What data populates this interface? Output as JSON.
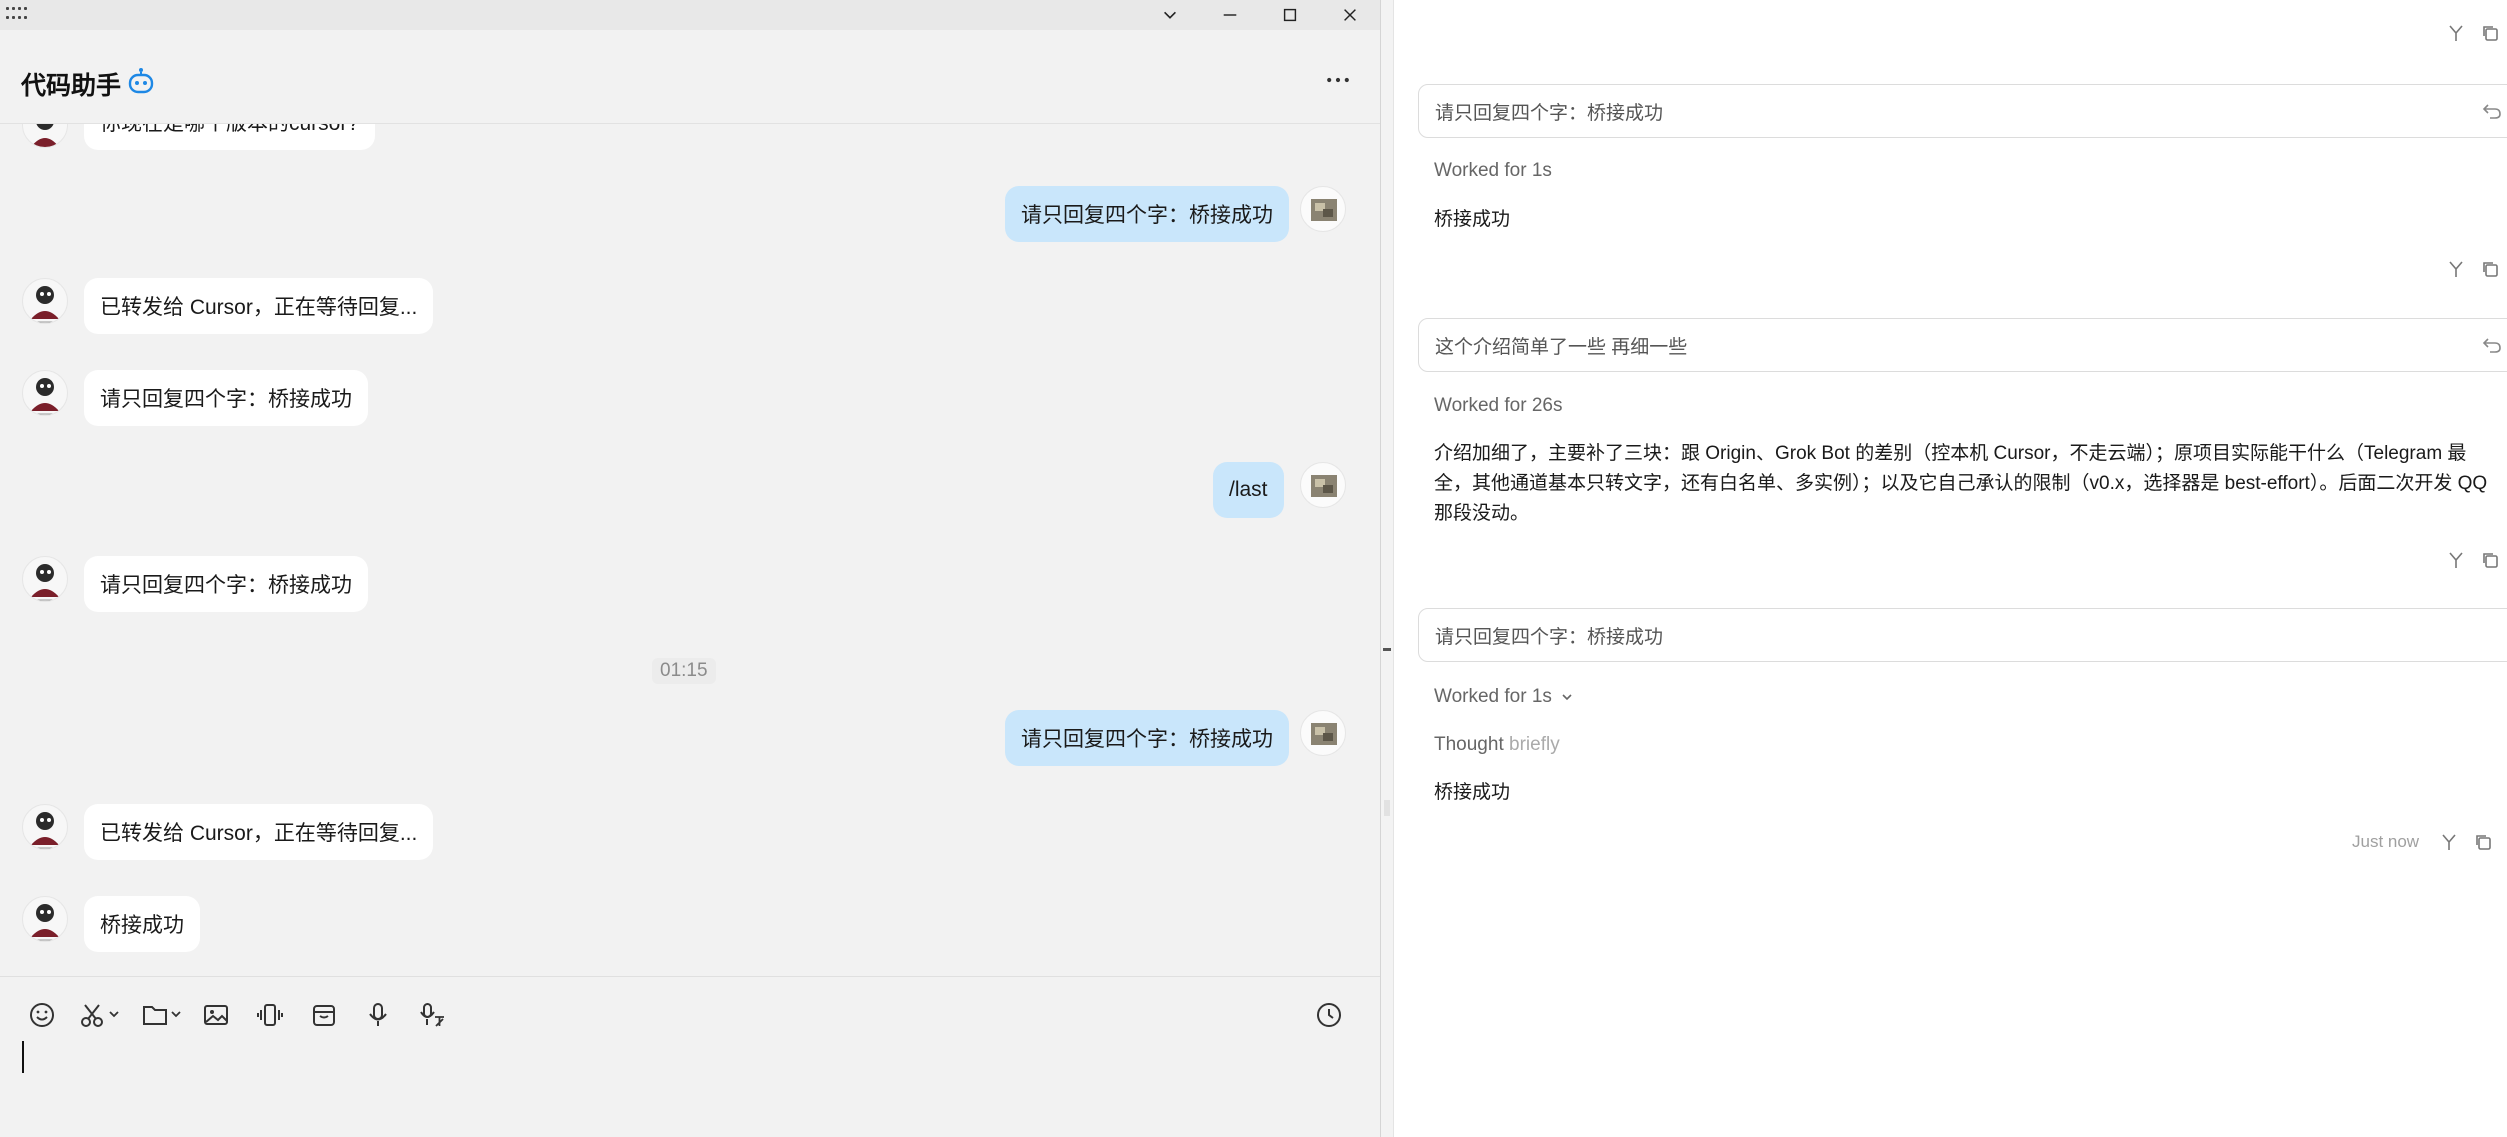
{
  "window": {
    "minimize": "—",
    "maximize": "☐",
    "close": "✕",
    "dropdown": "⌄"
  },
  "chat": {
    "title": "代码助手",
    "partial_message": "你现在是哪个版本的cursor?",
    "messages": [
      {
        "side": "out",
        "text": "请只回复四个字：桥接成功"
      },
      {
        "side": "in",
        "text": "已转发给 Cursor，正在等待回复..."
      },
      {
        "side": "in",
        "text": "请只回复四个字：桥接成功"
      },
      {
        "side": "out",
        "text": "/last"
      },
      {
        "side": "in",
        "text": "请只回复四个字：桥接成功"
      },
      {
        "side": "out",
        "text": "请只回复四个字：桥接成功"
      },
      {
        "side": "in",
        "text": "已转发给 Cursor，正在等待回复..."
      },
      {
        "side": "in",
        "text": "桥接成功"
      }
    ],
    "timestamp": "01:15",
    "toolbar_icons": [
      "emoji-icon",
      "scissors-icon",
      "folder-icon",
      "image-icon",
      "vibrate-icon",
      "gift-box-icon",
      "microphone-icon",
      "voice-to-text-icon",
      "history-clock-icon"
    ]
  },
  "agent": {
    "turns": [
      {
        "prompt": "请只回复四个字：桥接成功",
        "worked": "Worked for 1s",
        "reply": "桥接成功"
      },
      {
        "prompt": "这个介绍简单了一些 再细一些",
        "worked": "Worked for 26s",
        "reply": "介绍加细了，主要补了三块：跟 Origin、Grok Bot 的差别（控本机 Cursor，不走云端）；原项目实际能干什么（Telegram 最全，其他通道基本只转文字，还有白名单、多实例）；以及它自己承认的限制（v0.x，选择器是 best-effort）。后面二次开发 QQ 那段没动。"
      },
      {
        "prompt": "请只回复四个字：桥接成功",
        "worked": "Worked for 1s",
        "thought_label": "Thought",
        "thought_dim": "briefly",
        "reply": "桥接成功",
        "time": "Just now"
      }
    ]
  }
}
